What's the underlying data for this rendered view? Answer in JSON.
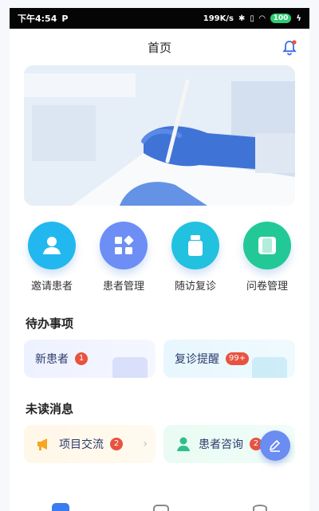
{
  "status_bar": {
    "time": "下午4:54",
    "network_speed": "199K/s",
    "battery": "100"
  },
  "header": {
    "title": "首页"
  },
  "grid": [
    {
      "label": "邀请患者",
      "icon": "person-icon",
      "color": "#22b8ef"
    },
    {
      "label": "患者管理",
      "icon": "apps-icon",
      "color": "#6c8ef5"
    },
    {
      "label": "随访复诊",
      "icon": "medicine-bottle-icon",
      "color": "#22c1e0"
    },
    {
      "label": "问卷管理",
      "icon": "questionnaire-icon",
      "color": "#22c996"
    }
  ],
  "todo": {
    "title": "待办事项",
    "items": [
      {
        "label": "新患者",
        "badge": "1"
      },
      {
        "label": "复诊提醒",
        "badge": "99+"
      }
    ]
  },
  "messages": {
    "title": "未读消息",
    "items": [
      {
        "label": "项目交流",
        "badge": "2",
        "icon": "megaphone-icon"
      },
      {
        "label": "患者咨询",
        "badge": "2",
        "icon": "user-icon"
      }
    ]
  },
  "colors": {
    "accent": "#6b8cf0",
    "badge": "#e8533f"
  }
}
